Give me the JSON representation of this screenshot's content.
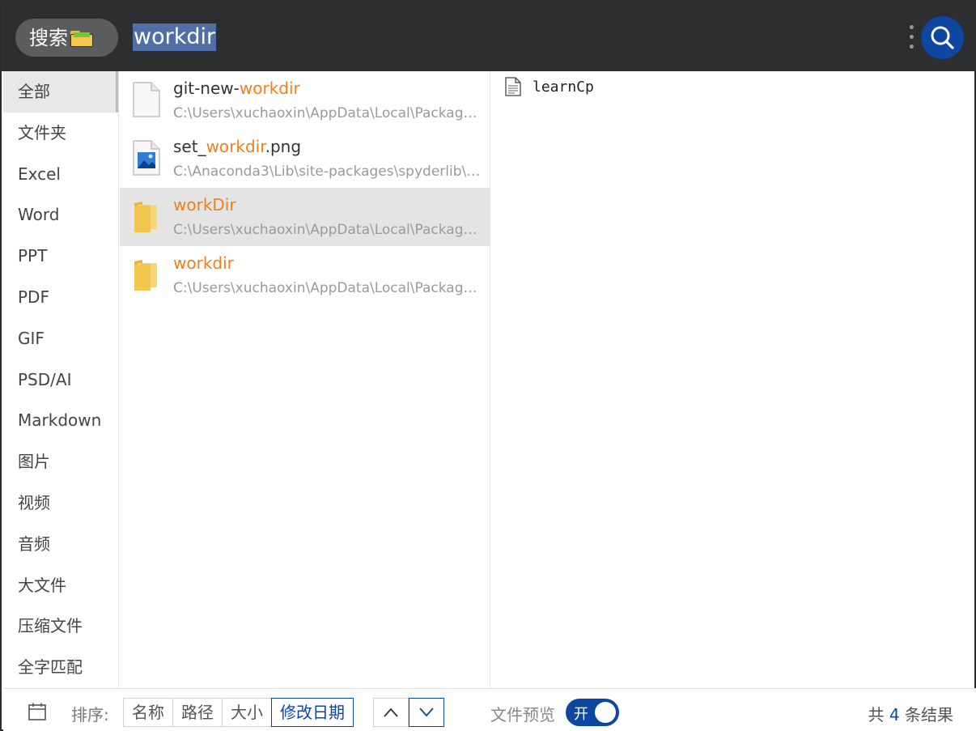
{
  "header": {
    "search_tag_label": "搜索",
    "search_tag_icon": "folder-emoji-icon",
    "query": "workdir",
    "more_icon": "vertical-dots-icon",
    "search_button_icon": "magnifier-icon"
  },
  "sidebar": {
    "items": [
      {
        "label": "全部",
        "active": true
      },
      {
        "label": "文件夹"
      },
      {
        "label": "Excel"
      },
      {
        "label": "Word"
      },
      {
        "label": "PPT"
      },
      {
        "label": "PDF"
      },
      {
        "label": "GIF"
      },
      {
        "label": "PSD/AI"
      },
      {
        "label": "Markdown"
      },
      {
        "label": "图片"
      },
      {
        "label": "视频"
      },
      {
        "label": "音频"
      },
      {
        "label": "大文件"
      },
      {
        "label": "压缩文件"
      },
      {
        "label": "全字匹配"
      }
    ]
  },
  "results": [
    {
      "name_before": "git-new-",
      "name_match": "workdir",
      "name_after": "",
      "path": "C:\\Users\\xuchaoxin\\AppData\\Local\\Packages\\...",
      "icon": "blank-file-icon",
      "selected": false
    },
    {
      "name_before": "set_",
      "name_match": "workdir",
      "name_after": ".png",
      "path": "C:\\Anaconda3\\Lib\\site-packages\\spyderlib\\im...",
      "icon": "image-file-icon",
      "selected": false
    },
    {
      "name_before": "",
      "name_match": "workDir",
      "name_after": "",
      "path": "C:\\Users\\xuchaoxin\\AppData\\Local\\Packages\\...",
      "icon": "folder-icon",
      "selected": true
    },
    {
      "name_before": "",
      "name_match": "workdir",
      "name_after": "",
      "path": "C:\\Users\\xuchaoxin\\AppData\\Local\\Packages\\...",
      "icon": "folder-icon",
      "selected": false
    }
  ],
  "preview": {
    "items": [
      {
        "name": "learnCp",
        "icon": "text-file-icon"
      }
    ]
  },
  "footer": {
    "calendar_icon": "calendar-icon",
    "sort_label": "排序:",
    "sort_options": [
      "名称",
      "路径",
      "大小",
      "修改日期"
    ],
    "sort_active": "修改日期",
    "sort_asc_icon": "chevron-up-icon",
    "sort_desc_icon": "chevron-down-icon",
    "preview_label": "文件预览",
    "preview_toggle_label": "开",
    "preview_toggle_on": true,
    "count_prefix": "共",
    "count_value": "4",
    "count_suffix": "条结果"
  },
  "colors": {
    "accent": "#0d47a1",
    "match_highlight": "#ef8019",
    "topbar_bg": "#2d2e30",
    "selection_bg": "#4f6fa6"
  }
}
